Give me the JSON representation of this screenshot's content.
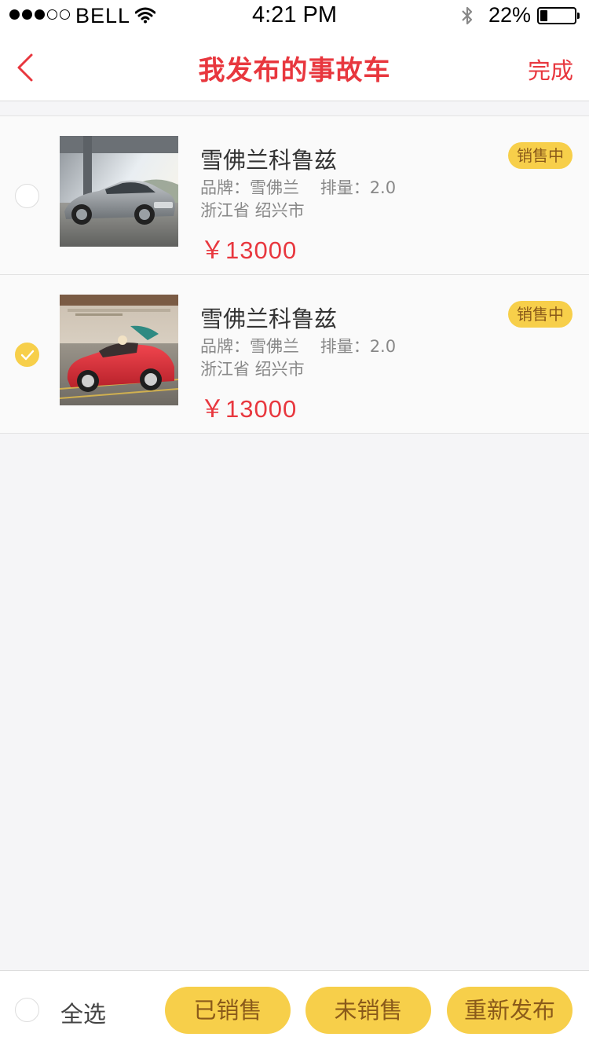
{
  "status_bar": {
    "carrier": "BELL",
    "time": "4:21 PM",
    "battery": "22%",
    "battery_level": 0.22
  },
  "nav": {
    "title": "我发布的事故车",
    "done_label": "完成"
  },
  "items": [
    {
      "name": "雪佛兰科鲁兹",
      "specs": "品牌：雪佛兰    排量：2.0",
      "location": "浙江省 绍兴市",
      "price": "￥13000",
      "status": "销售中",
      "checked": false
    },
    {
      "name": "雪佛兰科鲁兹",
      "specs": "品牌：雪佛兰    排量：2.0",
      "location": "浙江省 绍兴市",
      "price": "￥13000",
      "status": "销售中",
      "checked": true
    }
  ],
  "bottom_bar": {
    "select_all_label": "全选",
    "buttons": {
      "sold": "已销售",
      "unsold": "未销售",
      "republish": "重新发布"
    }
  },
  "colors": {
    "accent_red": "#e8373e",
    "accent_yellow": "#f7cf4a",
    "badge_text": "#8a5a1a"
  }
}
